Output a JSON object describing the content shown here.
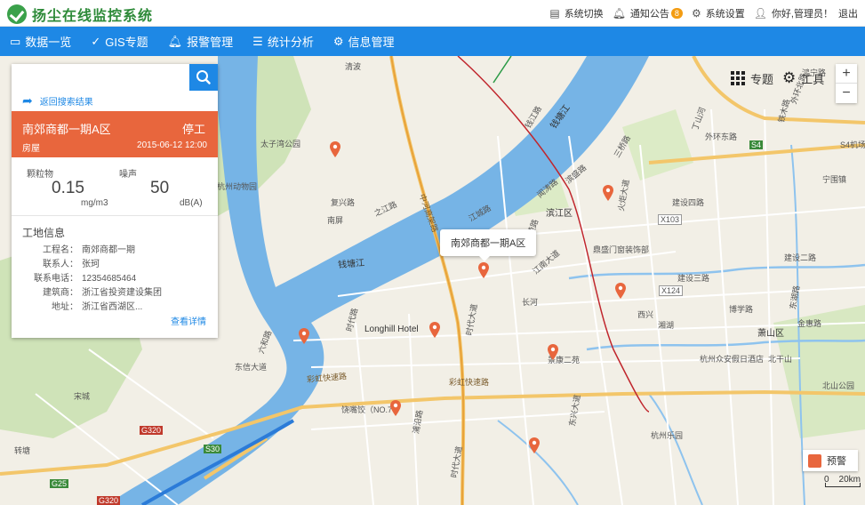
{
  "app": {
    "title": "扬尘在线监控系统"
  },
  "header": {
    "switch_label": "系统切换",
    "notice_label": "通知公告",
    "notice_count": "8",
    "settings_label": "系统设置",
    "greeting": "你好,管理员！",
    "logout_label": "退出"
  },
  "nav": [
    {
      "label": "数据一览"
    },
    {
      "label": "GIS专题"
    },
    {
      "label": "报警管理"
    },
    {
      "label": "统计分析"
    },
    {
      "label": "信息管理"
    }
  ],
  "search": {
    "value": "",
    "placeholder": ""
  },
  "panel": {
    "back_label": "返回搜索结果",
    "site_name": "南郊商都一期A区",
    "site_status": "停工",
    "site_type": "房屋",
    "site_date": "2015-06-12 12:00",
    "metric1_label": "颗粒物",
    "metric1_value": "0.15",
    "metric1_unit": "mg/m3",
    "metric2_label": "噪声",
    "metric2_value": "50",
    "metric2_unit": "dB(A)",
    "info_title": "工地信息",
    "info": [
      {
        "key": "工程名：",
        "val": "南郊商都一期"
      },
      {
        "key": "联系人：",
        "val": "张珂"
      },
      {
        "key": "联系电话：",
        "val": "12354685464"
      },
      {
        "key": "建筑商：",
        "val": "浙江省投资建设集团"
      },
      {
        "key": "地址：",
        "val": "浙江省西湖区..."
      }
    ],
    "detail_link": "查看详情"
  },
  "map": {
    "popup_label": "南郊商都一期A区",
    "tool_topic": "专题",
    "tool_tools": "工具",
    "zoom_in": "+",
    "zoom_out": "−",
    "alert_label": "预警",
    "scale_label": "20km",
    "scale_zero": "0",
    "labels": {
      "l1": "钱塘江",
      "l2": "钱塘江",
      "l3": "太子湾公园",
      "l4": "Longhill Hotel",
      "l5": "彩虹快速路",
      "l6": "彩虹快速路",
      "l7": "鼎盛门窗装饰部",
      "l8": "建设四路",
      "l9": "建设三路",
      "l10": "建设二路",
      "l11": "杭州众安假日酒店",
      "l12": "杭州乐园",
      "l13": "萧山区",
      "l14": "北山公园",
      "l15": "滨江区",
      "l16": "东信大道",
      "l17": "时代大道",
      "l18": "宋城",
      "l19": "饶嘴饺（NO.7",
      "l20": "景康二苑",
      "l21": "时代大道",
      "l22": "中河高架路",
      "l23": "外环东路",
      "l24": "S4机场",
      "l25": "X103",
      "l26": "X124",
      "l27": "S30",
      "l28": "G320",
      "l29": "G25",
      "l30": "G320",
      "l31": "之江路",
      "l32": "复兴路",
      "l33": "南屏",
      "l34": "清波",
      "l35": "S4",
      "l36": "博学路",
      "l37": "金惠路",
      "l38": "湘湖",
      "l39": "江陵路",
      "l40": "长河",
      "l41": "西兴",
      "l42": "闻涛路",
      "l43": "滨盛路",
      "l44": "火炬大道",
      "l45": "江南大道",
      "l46": "转塘",
      "l47": "江城路",
      "l48": "钱江路",
      "l49": "东湖路",
      "l50": "北干山",
      "l51": "东兴大道",
      "l52": "浦沿路",
      "l53": "杭州动物园",
      "l54": "六和路",
      "l55": "丁山河",
      "l56": "铁木路",
      "l57": "宁围镇",
      "l58": "三桥路",
      "l59": "外环北路",
      "l60": "鸿宁路",
      "l61": "时代路"
    }
  },
  "colors": {
    "brand": "#2d8a38",
    "nav": "#1e88e5",
    "accent": "#e8663d",
    "water": "#76b4e6"
  }
}
